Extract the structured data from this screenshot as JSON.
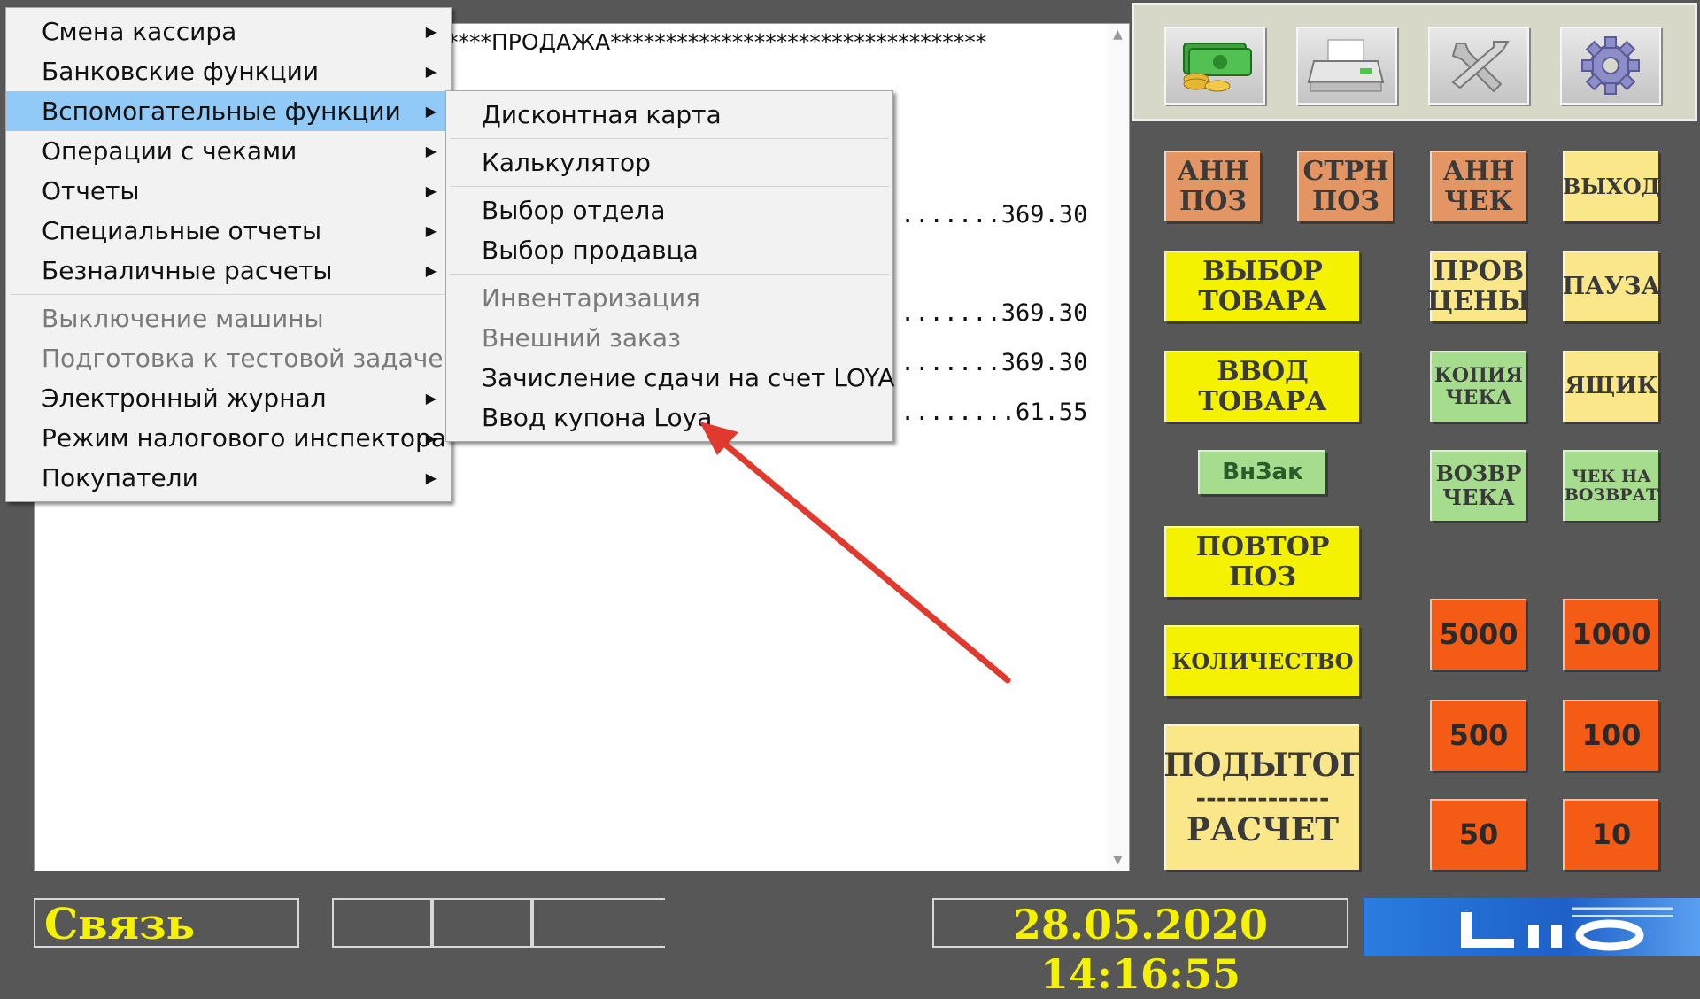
{
  "journal": {
    "header": "****ПРОДАЖА**********************************",
    "amounts": [
      ".......369.30",
      ".......369.30",
      ".......369.30",
      "........61.55"
    ]
  },
  "main_menu": {
    "items": [
      {
        "label": "Смена кассира",
        "submenu": true
      },
      {
        "label": "Банковские функции",
        "submenu": true
      },
      {
        "label": "Вспомогательные функции",
        "submenu": true,
        "selected": true
      },
      {
        "label": "Операции с чеками",
        "submenu": true
      },
      {
        "label": "Отчеты",
        "submenu": true
      },
      {
        "label": "Специальные отчеты",
        "submenu": true
      },
      {
        "label": "Безналичные расчеты",
        "submenu": true
      },
      {
        "label": "Выключение машины",
        "disabled": true
      },
      {
        "label": "Подготовка к тестовой задаче",
        "disabled": true
      },
      {
        "label": "Электронный журнал",
        "submenu": true
      },
      {
        "label": "Режим налогового инспектора",
        "submenu": true
      },
      {
        "label": "Покупатели",
        "submenu": true
      }
    ]
  },
  "sub_menu": {
    "items": [
      {
        "label": "Дисконтная карта"
      },
      {
        "label": "Калькулятор"
      },
      {
        "label": "Выбор отдела"
      },
      {
        "label": "Выбор продавца"
      },
      {
        "label": "Инвентаризация",
        "disabled": true
      },
      {
        "label": "Внешний заказ",
        "disabled": true
      },
      {
        "label": "Зачисление сдачи на счет LOYA"
      },
      {
        "label": "Ввод купона Loya"
      }
    ]
  },
  "toolbar": {
    "icons": [
      "money-icon",
      "printer-icon",
      "wrench-icon",
      "gear-icon"
    ]
  },
  "buttons": {
    "ann_poz": "АНН ПОЗ",
    "strn_poz": "СТРН ПОЗ",
    "ann_chek": "АНН ЧЕК",
    "vyhod": "ВЫХОД",
    "vybor_tovara": "ВЫБОР ТОВАРА",
    "prov_ceny": "ПРОВ ЦЕНЫ",
    "pauza": "ПАУЗА",
    "vvod_tovara": "ВВОД ТОВАРА",
    "kopiya_cheka": "КОПИЯ ЧЕКА",
    "yashchik": "ЯЩИК",
    "vnzak": "ВнЗак",
    "vozvr_cheka": "ВОЗВР ЧЕКА",
    "chek_na_vozvrat": "ЧЕК НА ВОЗВРАТ",
    "povtor_poz": "ПОВТОР ПОЗ",
    "kolichestvo": "КОЛИЧЕСТВО",
    "podytog": "ПОДЫТОГ",
    "podytog_sep": "-------------",
    "raschet": "РАСЧЕТ",
    "n5000": "5000",
    "n1000": "1000",
    "n500": "500",
    "n100": "100",
    "n50": "50",
    "n10": "10"
  },
  "status": {
    "connection": "Связь",
    "datetime": "28.05.2020 14:16:55"
  },
  "colors": {
    "orange": "#e39664",
    "yellow": "#f4f201",
    "light_yellow": "#f9e78a",
    "green": "#a6dc8e",
    "red": "#f45b14",
    "highlight": "#91c9f7",
    "arrow": "#e03a2e"
  }
}
